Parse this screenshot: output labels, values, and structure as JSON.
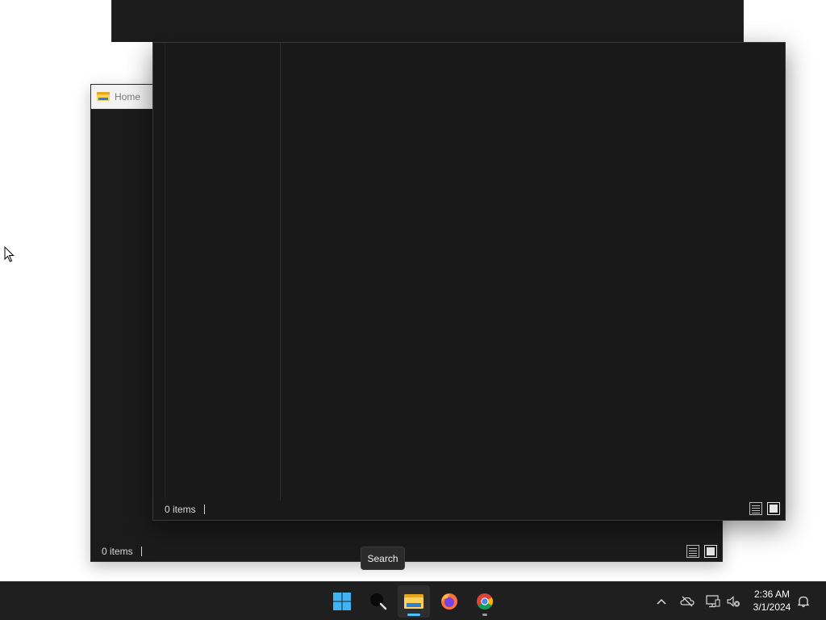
{
  "windows": {
    "back_tab": {
      "label": "Home",
      "icon": "folder-icon"
    },
    "middle": {
      "status_items": "0 items"
    },
    "front": {
      "status_items": "0 items"
    }
  },
  "tooltip": {
    "text": "Search"
  },
  "taskbar": {
    "apps": [
      {
        "name": "Start",
        "icon": "windows-logo-icon"
      },
      {
        "name": "Search",
        "icon": "search-icon"
      },
      {
        "name": "File Explorer",
        "icon": "folder-icon",
        "active": true
      },
      {
        "name": "Firefox",
        "icon": "firefox-icon"
      },
      {
        "name": "Chrome",
        "icon": "chrome-icon"
      }
    ],
    "tray": {
      "overflow_icon": "chevron-up-icon",
      "onedrive_icon": "cloud-offline-icon",
      "network_icon": "network-icon",
      "volume_icon": "volume-muted-icon",
      "notification_icon": "bell-icon"
    },
    "clock": {
      "time": "2:36 AM",
      "date": "3/1/2024"
    }
  },
  "colors": {
    "window_bg": "#191919",
    "taskbar_bg": "#1f1f1f",
    "accent": "#4cc2ff"
  }
}
